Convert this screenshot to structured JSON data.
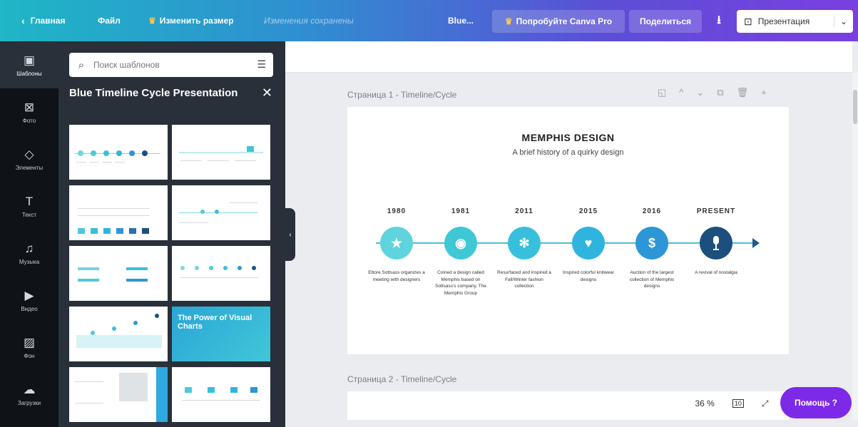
{
  "topbar": {
    "home": "Главная",
    "file": "Файл",
    "resize": "Изменить размер",
    "saved_status": "Изменения сохранены",
    "doc_title": "Blue...",
    "try_pro": "Попробуйте Canva Pro",
    "share": "Поделиться",
    "present": "Презентация"
  },
  "rail": [
    {
      "label": "Шаблоны",
      "icon": "▣"
    },
    {
      "label": "Фото",
      "icon": "🖼"
    },
    {
      "label": "Элементы",
      "icon": "◇"
    },
    {
      "label": "Текст",
      "icon": "T"
    },
    {
      "label": "Музыка",
      "icon": "♫"
    },
    {
      "label": "Видео",
      "icon": "▶"
    },
    {
      "label": "Фон",
      "icon": "▨"
    },
    {
      "label": "Загрузки",
      "icon": "☁"
    }
  ],
  "panel": {
    "search_placeholder": "Поиск шаблонов",
    "title": "Blue Timeline Cycle Presentation",
    "thumb_power_text": "The Power of Visual Charts"
  },
  "canvas": {
    "page1_label": "Страница 1 - Timeline/Cycle",
    "page2_label": "Страница 2 - Timeline/Cycle",
    "zoom": "36 %",
    "help": "Помощь ?"
  },
  "slide": {
    "title": "MEMPHIS DESIGN",
    "subtitle": "A brief history of a quirky design",
    "timeline": [
      {
        "year": "1980",
        "icon": "★",
        "color": "#5fd3de",
        "desc": "Ettore Sottsass organizes a meeting with designers"
      },
      {
        "year": "1981",
        "icon": "◉",
        "color": "#3ec8d6",
        "desc": "Coined a design called Memphis based on Sottsass's company, The Memphis Group"
      },
      {
        "year": "2011",
        "icon": "✻",
        "color": "#38bfdc",
        "desc": "Resurfaced and inspired a Fall/Winter fashion collection"
      },
      {
        "year": "2015",
        "icon": "♥",
        "color": "#2fb4df",
        "desc": "Inspired colorful knitwear designs"
      },
      {
        "year": "2016",
        "icon": "$",
        "color": "#2d96d6",
        "desc": "Auction of the largest collection of Memphis designs"
      },
      {
        "year": "PRESENT",
        "icon": "🎙",
        "color": "#1d4f7e",
        "desc": "A revival of nostalgia"
      }
    ]
  },
  "colors": {
    "topbar_start": "#1fb6c6",
    "topbar_end": "#7a3fe0",
    "panel_bg": "#293039",
    "rail_bg": "#0f1217",
    "help_bg": "#7d2ae8"
  }
}
